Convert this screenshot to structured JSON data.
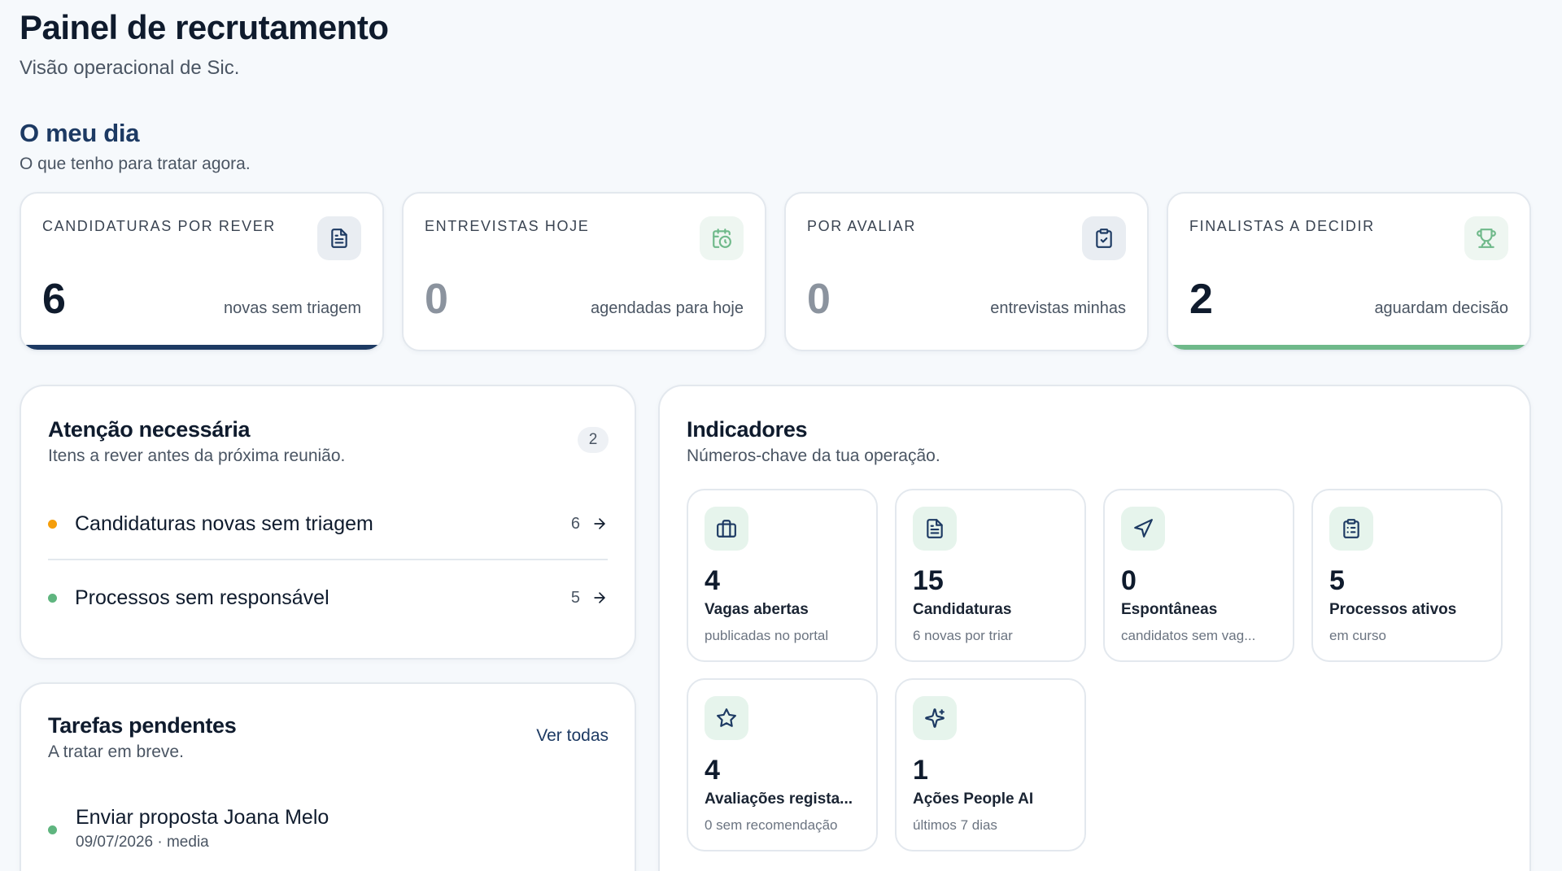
{
  "header": {
    "title": "Painel de recrutamento",
    "subtitle": "Visão operacional de Sic."
  },
  "my_day": {
    "title": "O meu dia",
    "subtitle": "O que tenho para tratar agora."
  },
  "kpis": [
    {
      "label": "CANDIDATURAS POR REVER",
      "value": "6",
      "caption": "novas sem triagem",
      "icon": "document-icon",
      "accent": "#1d3a63"
    },
    {
      "label": "ENTREVISTAS HOJE",
      "value": "0",
      "caption": "agendadas para hoje",
      "icon": "calendar-clock-icon",
      "accent": ""
    },
    {
      "label": "POR AVALIAR",
      "value": "0",
      "caption": "entrevistas minhas",
      "icon": "clipboard-check-icon",
      "accent": ""
    },
    {
      "label": "FINALISTAS A DECIDIR",
      "value": "2",
      "caption": "aguardam decisão",
      "icon": "trophy-icon",
      "accent": "#6fb98a"
    }
  ],
  "attention": {
    "title": "Atenção necessária",
    "subtitle": "Itens a rever antes da próxima reunião.",
    "badge": "2",
    "items": [
      {
        "label": "Candidaturas novas sem triagem",
        "count": "6",
        "dot_color": "#f59e0b"
      },
      {
        "label": "Processos sem responsável",
        "count": "5",
        "dot_color": "#5fb57f"
      }
    ]
  },
  "tasks": {
    "title": "Tarefas pendentes",
    "subtitle": "A tratar em breve.",
    "link_label": "Ver todas",
    "items": [
      {
        "title": "Enviar proposta Joana Melo",
        "meta": "09/07/2026 · media",
        "dot_color": "#5fb57f"
      }
    ]
  },
  "indicators": {
    "title": "Indicadores",
    "subtitle": "Números-chave da tua operação.",
    "cards": [
      {
        "value": "4",
        "label": "Vagas abertas",
        "caption": "publicadas no portal",
        "icon": "briefcase-icon"
      },
      {
        "value": "15",
        "label": "Candidaturas",
        "caption": "6 novas por triar",
        "icon": "document-icon"
      },
      {
        "value": "0",
        "label": "Espontâneas",
        "caption": "candidatos sem vag...",
        "icon": "send-icon"
      },
      {
        "value": "5",
        "label": "Processos ativos",
        "caption": "em curso",
        "icon": "clipboard-list-icon"
      },
      {
        "value": "4",
        "label": "Avaliações regista...",
        "caption": "0 sem recomendação",
        "icon": "star-icon"
      },
      {
        "value": "1",
        "label": "Ações People AI",
        "caption": "últimos 7 dias",
        "icon": "sparkles-icon"
      }
    ]
  },
  "colors": {
    "navy": "#1d3a63",
    "green": "#6fb98a",
    "muted_value": "#8b939e"
  }
}
